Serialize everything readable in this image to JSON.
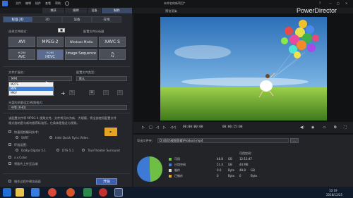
{
  "menubar": {
    "items": [
      "文件",
      "编辑",
      "插件",
      "查看",
      "帮助"
    ],
    "project_name": "未命名的新项目*"
  },
  "top_tabs": [
    "捕获",
    "编辑",
    "设备",
    "制作"
  ],
  "active_top_tab": 3,
  "preview_label": "预览渲染",
  "brand": "PowerDirector",
  "left": {
    "sub_tabs": [
      "标准 2D",
      "3D",
      "设备",
      "在线"
    ],
    "choose_format_label": "选择文件格式：",
    "profile_name_label": "配置文件分析器",
    "formats_row1": [
      "AVI",
      "MPEG-2",
      "Windows Media",
      "XAVC S"
    ],
    "formats_row2": [
      {
        "top": "H.264",
        "main": "AVC"
      },
      {
        "top": "H.265",
        "main": "HEVC"
      },
      {
        "top": "",
        "main": "Image Sequence"
      },
      {
        "top": "",
        "main": "♫"
      }
    ],
    "file_ext_label": "文件扩展名：",
    "file_ext_value": "MP4",
    "profile_type_label": "配置文件类型：",
    "profile_type_value": "默认",
    "dropdown_options": [
      "M2TS",
      "MP4",
      "MKV"
    ],
    "selected_option": "MP4",
    "quality_label": "光盘的质量设定/视频格式：",
    "quality_value": "中等 (FHD)",
    "description_1": "该配置文件将 MPEG-4 视频文件。文件将另存为新、大规模，将全部使用配置文件",
    "description_2": "格式指的是与新的推荐标准所，它具体是指过与视频。",
    "fast_render_label": "快速视频编码技术：",
    "svrt_label": "SVRT",
    "intel_label": "Intel Quick Sync Video",
    "audio_settings_label": "环绕设置：",
    "dolby_label": "Dolby Digital 5.1",
    "dts_label": "DTS 5.1",
    "truetheater_label": "TrueTheater Surround",
    "xcolor_label": "x.v.Color",
    "upload_label": "将影片上传至云端",
    "preview_after_label": "制作过程中预览画面",
    "start_button": "开始"
  },
  "player": {
    "current_time": "00:00:00:00",
    "total_time": "00:00:15:00"
  },
  "export": {
    "folder_label": "导出文件夹：",
    "path": "D:\\欣欣\\视频剪辑\\Produce.mp4",
    "estimated_label": "可用空间：",
    "duration_value": "12:13:47",
    "size_value": "44 MB",
    "disk_rows": [
      {
        "name": "可用",
        "value": "48.8",
        "unit": "GB",
        "color": "#6fbf45"
      },
      {
        "name": "已用空间",
        "value": "51.4",
        "unit": "GB",
        "color": "#3c7ad6"
      },
      {
        "name": "制作",
        "value": "0.0",
        "unit": "Byte",
        "color": "#d8d8d8"
      },
      {
        "name": "已制作",
        "value": "0",
        "unit": "Byte",
        "color": "#e0a030"
      }
    ],
    "disk_extra": [
      {
        "value": "48.8",
        "unit": "GB"
      },
      {
        "value": "0",
        "unit": "Byte"
      }
    ],
    "pie_free_fraction": 0.49
  },
  "taskbar": {
    "time": "10:19",
    "date": "2018/12/25"
  }
}
